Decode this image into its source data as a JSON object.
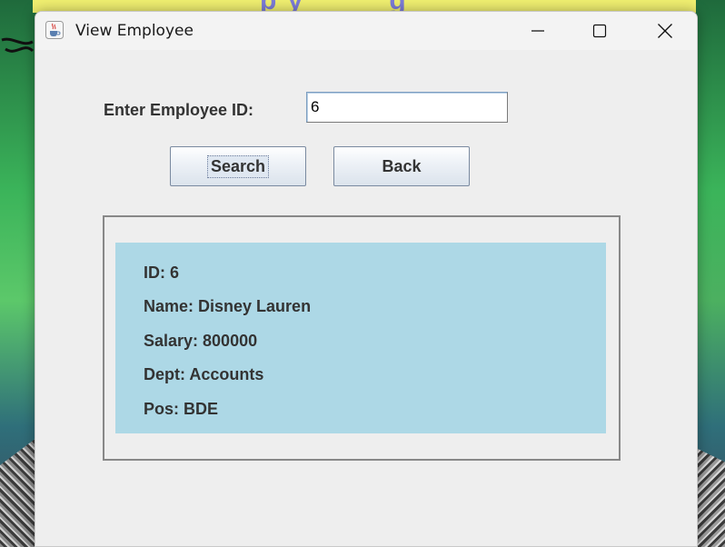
{
  "window": {
    "title": "View Employee",
    "minimize_label": "Minimize",
    "maximize_label": "Maximize",
    "close_label": "Close"
  },
  "form": {
    "id_label": "Enter Employee ID:",
    "id_value": "6",
    "search_label": "Search",
    "back_label": "Back"
  },
  "employee": {
    "id": "ID: 6",
    "name": "Name: Disney Lauren",
    "salary": "Salary: 800000",
    "dept": "Dept: Accounts",
    "pos": "Pos: BDE"
  },
  "colors": {
    "result_bg": "#add8e6",
    "window_bg": "#eeeeee",
    "label_text": "#333333"
  },
  "icons": {
    "app": "java-cup-icon",
    "minimize": "minimize-icon",
    "maximize": "maximize-icon",
    "close": "close-icon"
  }
}
